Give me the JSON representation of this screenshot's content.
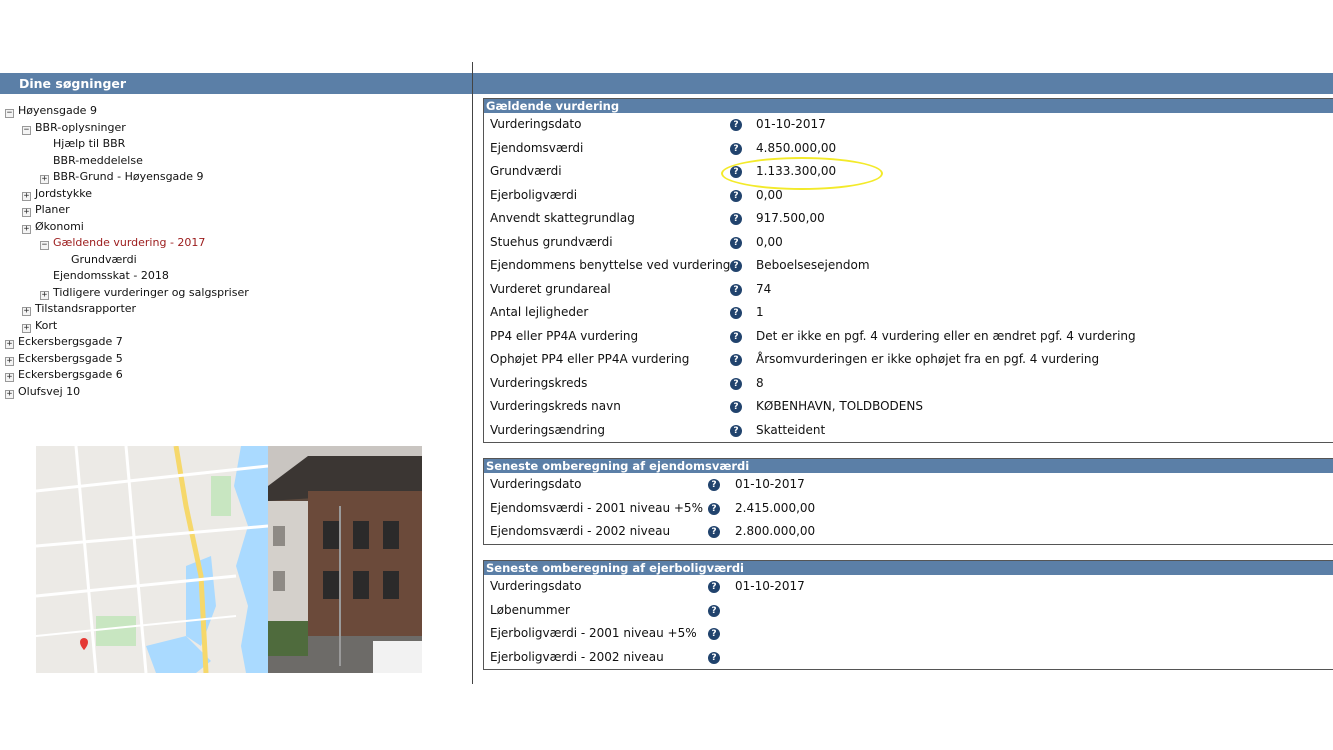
{
  "left_panel": {
    "title": "Dine søgninger"
  },
  "tree": [
    {
      "label": "Høyensgade 9",
      "toggle": "−"
    },
    {
      "label": "BBR-oplysninger",
      "toggle": "−"
    },
    {
      "label": "Hjælp til BBR",
      "toggle": ""
    },
    {
      "label": "BBR-meddelelse",
      "toggle": ""
    },
    {
      "label": "BBR-Grund - Høyensgade 9",
      "toggle": "+"
    },
    {
      "label": "Jordstykke",
      "toggle": "+"
    },
    {
      "label": "Planer",
      "toggle": "+"
    },
    {
      "label": "Økonomi",
      "toggle": "+"
    },
    {
      "label": "Gældende vurdering - 2017",
      "toggle": "−"
    },
    {
      "label": "Grundværdi",
      "toggle": ""
    },
    {
      "label": "Ejendomsskat - 2018",
      "toggle": ""
    },
    {
      "label": "Tidligere vurderinger og salgspriser",
      "toggle": "+"
    },
    {
      "label": "Tilstandsrapporter",
      "toggle": "+"
    },
    {
      "label": "Kort",
      "toggle": "+"
    },
    {
      "label": "Eckersbergsgade 7",
      "toggle": "+"
    },
    {
      "label": "Eckersbergsgade 5",
      "toggle": "+"
    },
    {
      "label": "Eckersbergsgade 6",
      "toggle": "+"
    },
    {
      "label": "Olufsvej 10",
      "toggle": "+"
    }
  ],
  "help_glyph": "?",
  "panels": {
    "current": {
      "title": "Gældende vurdering",
      "rows": [
        {
          "label": "Vurderingsdato",
          "value": "01-10-2017"
        },
        {
          "label": "Ejendomsværdi",
          "value": "4.850.000,00"
        },
        {
          "label": "Grundværdi",
          "value": "1.133.300,00"
        },
        {
          "label": "Ejerboligværdi",
          "value": "0,00"
        },
        {
          "label": "Anvendt skattegrundlag",
          "value": "917.500,00"
        },
        {
          "label": "Stuehus grundværdi",
          "value": "0,00"
        },
        {
          "label": "Ejendommens benyttelse ved vurdering",
          "value": "Beboelsesejendom"
        },
        {
          "label": "Vurderet grundareal",
          "value": "74"
        },
        {
          "label": "Antal lejligheder",
          "value": "1"
        },
        {
          "label": "PP4 eller PP4A vurdering",
          "value": "Det er ikke en pgf. 4 vurdering eller en ændret pgf. 4 vurdering"
        },
        {
          "label": "Ophøjet PP4 eller PP4A vurdering",
          "value": "Årsomvurderingen er ikke ophøjet fra en pgf. 4 vurdering"
        },
        {
          "label": "Vurderingskreds",
          "value": "8"
        },
        {
          "label": "Vurderingskreds navn",
          "value": "KØBENHAVN, TOLDBODENS"
        },
        {
          "label": "Vurderingsændring",
          "value": "Skatteident"
        }
      ]
    },
    "property_recalc": {
      "title": "Seneste omberegning af ejendomsværdi",
      "rows": [
        {
          "label": "Vurderingsdato",
          "value": "01-10-2017"
        },
        {
          "label": "Ejendomsværdi - 2001 niveau +5%",
          "value": "2.415.000,00"
        },
        {
          "label": "Ejendomsværdi - 2002 niveau",
          "value": "2.800.000,00"
        }
      ]
    },
    "owner_recalc": {
      "title": "Seneste omberegning af ejerboligværdi",
      "rows": [
        {
          "label": "Vurderingsdato",
          "value": "01-10-2017"
        },
        {
          "label": "Løbenummer",
          "value": ""
        },
        {
          "label": "Ejerboligværdi - 2001 niveau +5%",
          "value": ""
        },
        {
          "label": "Ejerboligværdi - 2002 niveau",
          "value": ""
        }
      ]
    }
  },
  "colors": {
    "header_blue": "#5b7fa7",
    "help_icon": "#21436d",
    "active_link": "#9b1b1b",
    "highlight": "#f3ea2a"
  }
}
